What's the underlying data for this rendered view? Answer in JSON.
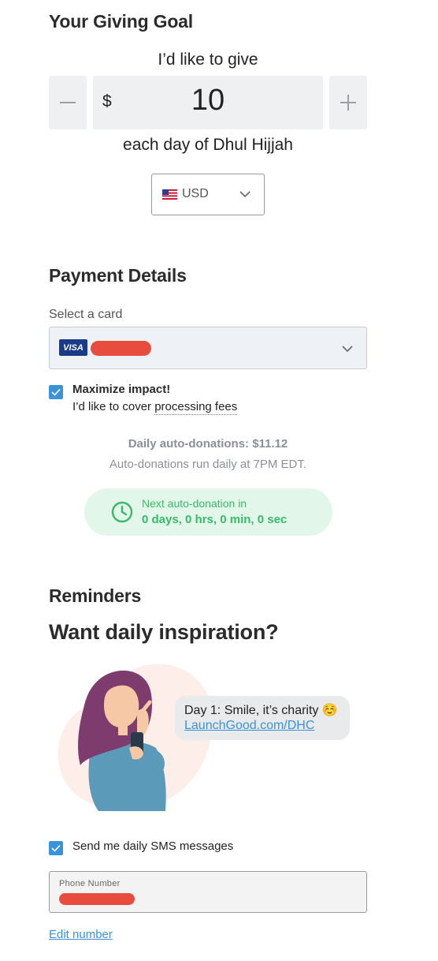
{
  "giving_goal": {
    "heading": "Your Giving Goal",
    "intro": "I’d like to give",
    "currency_symbol": "$",
    "amount": "10",
    "suffix": "each day of Dhul Hijjah",
    "currency_code": "USD",
    "currency_flag": "us-flag-icon"
  },
  "payment": {
    "heading": "Payment Details",
    "card_label": "Select a card",
    "card_brand": "VISA",
    "maximize_title": "Maximize impact!",
    "maximize_text_prefix": "I’d like to cover ",
    "maximize_text_link": "processing fees",
    "maximize_checked": true,
    "daily_total": "Daily auto-donations: $11.12",
    "schedule": "Auto-donations run daily at 7PM EDT.",
    "next_label": "Next auto-donation in",
    "next_countdown": "0 days, 0 hrs, 0 min, 0 sec"
  },
  "reminders": {
    "heading": "Reminders",
    "title": "Want daily inspiration?",
    "bubble_line1": "Day 1: Smile, it’s charity ☺️",
    "bubble_link": "LaunchGood.com/DHC",
    "sms_label": "Send me daily SMS messages",
    "sms_checked": true,
    "phone_label": "Phone Number",
    "edit_link": "Edit number"
  },
  "colors": {
    "accent": "#3a93d8",
    "success": "#3bb96a",
    "success_bg": "#e2f7ea",
    "redaction": "#e74c3c"
  }
}
